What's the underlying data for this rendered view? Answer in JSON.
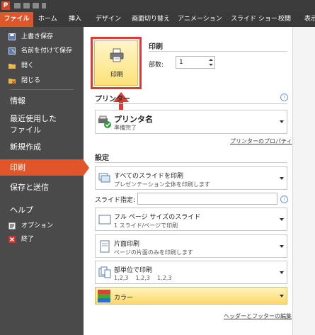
{
  "titlebar": {
    "app_icon": "P"
  },
  "tabs": [
    "ファイル",
    "ホーム",
    "挿入",
    "デザイン",
    "画面切り替え",
    "アニメーション",
    "スライド ショー",
    "校閲",
    "表示"
  ],
  "left_menu": {
    "save": "上書き保存",
    "save_as": "名前を付けて保存",
    "open": "開く",
    "close": "閉じる",
    "info": "情報",
    "recent_line1": "最近使用した",
    "recent_line2": "ファイル",
    "new": "新規作成",
    "print": "印刷",
    "save_send": "保存と送信",
    "help": "ヘルプ",
    "options": "オプション",
    "exit": "終了"
  },
  "print_section": {
    "title": "印刷",
    "button_label": "印刷",
    "copies_label": "部数:",
    "copies_value": "1"
  },
  "printer_section": {
    "title": "プリンター",
    "printer_name": "プリンタ名",
    "printer_status": "準備完了",
    "properties_link": "プリンターのプロパティ"
  },
  "settings": {
    "title": "設定",
    "slides_main": "すべてのスライドを印刷",
    "slides_sub": "プレゼンテーション全体を印刷します",
    "slide_spec_label": "スライド指定:",
    "layout_main": "フル ページ サイズのスライド",
    "layout_sub": "1 スライド/ページで印刷",
    "sides_main": "片面印刷",
    "sides_sub": "ページの片面のみを印刷します",
    "collate_main": "部単位で印刷",
    "collate_sub": "1,2,3    1,2,3    1,2,3",
    "color_main": "カラー",
    "header_footer_link": "ヘッダーとフッターの編集"
  },
  "colors": {
    "accent": "#e0562a",
    "dark_bg": "#4a4a4a",
    "highlight_border": "#e13a36",
    "button_yellow": "#fde27a"
  }
}
